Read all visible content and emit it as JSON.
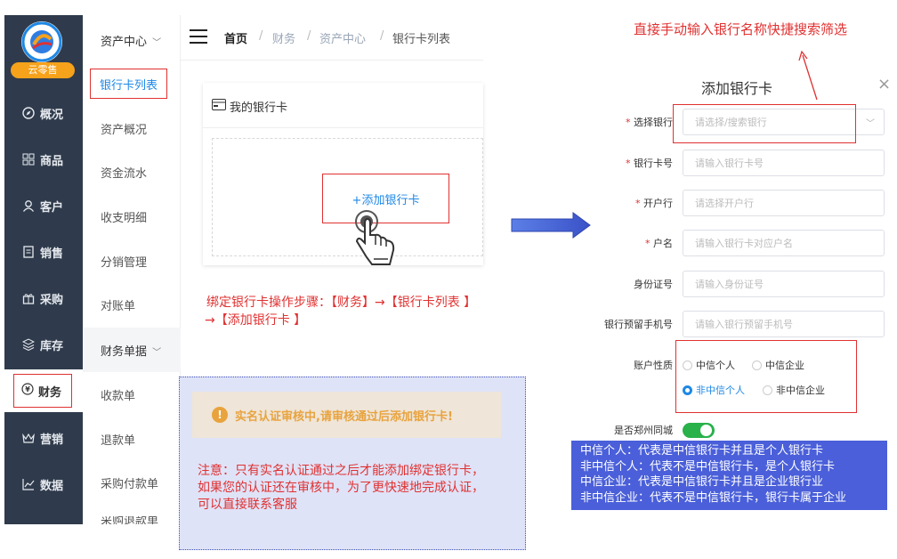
{
  "sidebar": {
    "badge": "云零售",
    "items": [
      {
        "label": "概况",
        "icon": "compass-icon"
      },
      {
        "label": "商品",
        "icon": "grid-icon"
      },
      {
        "label": "客户",
        "icon": "person-icon"
      },
      {
        "label": "销售",
        "icon": "document-icon"
      },
      {
        "label": "采购",
        "icon": "gift-icon"
      },
      {
        "label": "库存",
        "icon": "layers-icon"
      },
      {
        "label": "财务",
        "icon": "money-icon"
      },
      {
        "label": "营销",
        "icon": "crown-icon"
      },
      {
        "label": "数据",
        "icon": "chart-icon"
      }
    ]
  },
  "submenu": {
    "group1": "资产中心",
    "active": "银行卡列表",
    "items1": [
      "资产概况",
      "资金流水",
      "收支明细",
      "分销管理",
      "对账单"
    ],
    "group2": "财务单据",
    "items2": [
      "收款单",
      "退款单",
      "采购付款单",
      "采购退款单"
    ]
  },
  "breadcrumb": [
    "首页",
    "财务",
    "资产中心",
    "银行卡列表"
  ],
  "card": {
    "title": "我的银行卡",
    "add_button": "+添加银行卡"
  },
  "steps_note": {
    "line1": "绑定银行卡操作步骤：【财务】→【银行卡列表 】",
    "line2": "→【添加银行卡 】"
  },
  "notice": {
    "warning": "实名认证审核中,请审核通过后添加银行卡!",
    "text": "注意：只有实名认证通过之后才能添加绑定银行卡，如果您的认证还在审核中，为了更快速地完成认证，可以直接联系客服"
  },
  "top_note": "直接手动输入银行名称快捷搜索筛选",
  "form": {
    "title": "添加银行卡",
    "fields": [
      {
        "label": "选择银行",
        "required": true,
        "placeholder": "请选择/搜索银行"
      },
      {
        "label": "银行卡号",
        "required": true,
        "placeholder": "请输入银行卡号"
      },
      {
        "label": "开户行",
        "required": true,
        "placeholder": "请选择开户行"
      },
      {
        "label": "户名",
        "required": true,
        "placeholder": "请输入银行卡对应户名"
      },
      {
        "label": "身份证号",
        "required": false,
        "placeholder": "请输入身份证号"
      },
      {
        "label": "银行预留手机号",
        "required": false,
        "placeholder": "请输入银行预留手机号"
      }
    ],
    "account_type_label": "账户性质",
    "account_types": [
      "中信个人",
      "中信企业",
      "非中信个人",
      "非中信企业"
    ],
    "account_type_selected": "非中信个人",
    "same_city_label": "是否郑州同城",
    "same_city_on": true
  },
  "legend": [
    "中信个人：代表是中信银行卡并且是个人银行卡",
    "非中信个人：代表不是中信银行卡，是个人银行卡",
    "中信企业：代表是中信银行卡并且是企业银行业",
    "非中信企业：代表不是中信银行卡，银行卡属于企业"
  ],
  "colors": {
    "sidebar": "#2f3b4c",
    "accent": "#1e88e5",
    "annotation": "#e03131",
    "legend_bg": "#4a5fd9",
    "toggle": "#29b14a"
  }
}
